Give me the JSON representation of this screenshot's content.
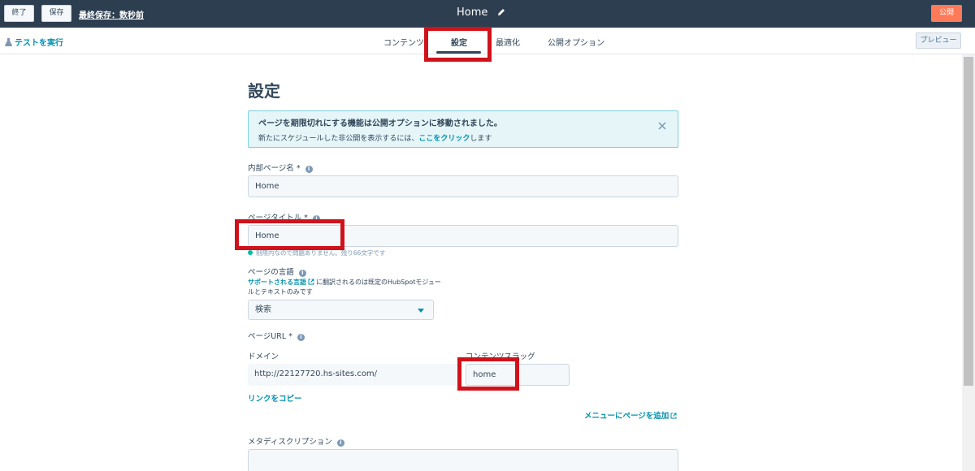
{
  "topbar": {
    "exit_label": "終了",
    "save_label": "保存",
    "last_saved": "最終保存：数秒前",
    "page_name": "Home",
    "publish_label": "公開"
  },
  "subnav": {
    "test_run": "テストを実行",
    "tabs": [
      {
        "label": "コンテンツ"
      },
      {
        "label": "設定",
        "active": true
      },
      {
        "label": "最適化"
      },
      {
        "label": "公開オプション"
      }
    ],
    "preview_label": "プレビュー"
  },
  "main": {
    "title": "設定",
    "alert": {
      "title": "ページを期限切れにする機能は公開オプションに移動されました。",
      "body_prefix": "新たにスケジュールした非公開を表示するには、",
      "link": "ここをクリック",
      "body_suffix": "します"
    },
    "internal_name": {
      "label": "内部ページ名 *",
      "value": "Home"
    },
    "page_title": {
      "label": "ページタイトル *",
      "value": "Home",
      "hint": "制限内なので問題ありません。残り66文字です"
    },
    "language": {
      "label": "ページの言語",
      "link": "サポートされる言語",
      "desc": "に翻訳されるのは既定のHubSpotモジュールとテキストのみです",
      "value": "検索"
    },
    "url": {
      "label": "ページURL *",
      "domain_label": "ドメイン",
      "domain_value": "http://22127720.hs-sites.com/",
      "slug_label": "コンテンツスラッグ",
      "slug_value": "home",
      "copy_link": "リンクをコピー"
    },
    "add_to_menu": "メニューにページを追加",
    "meta": {
      "label": "メタディスクリプション"
    }
  },
  "colors": {
    "topbar": "#2d3e50",
    "accent": "#0091ae",
    "publish": "#ff7a59",
    "highlight": "#d0121b"
  }
}
